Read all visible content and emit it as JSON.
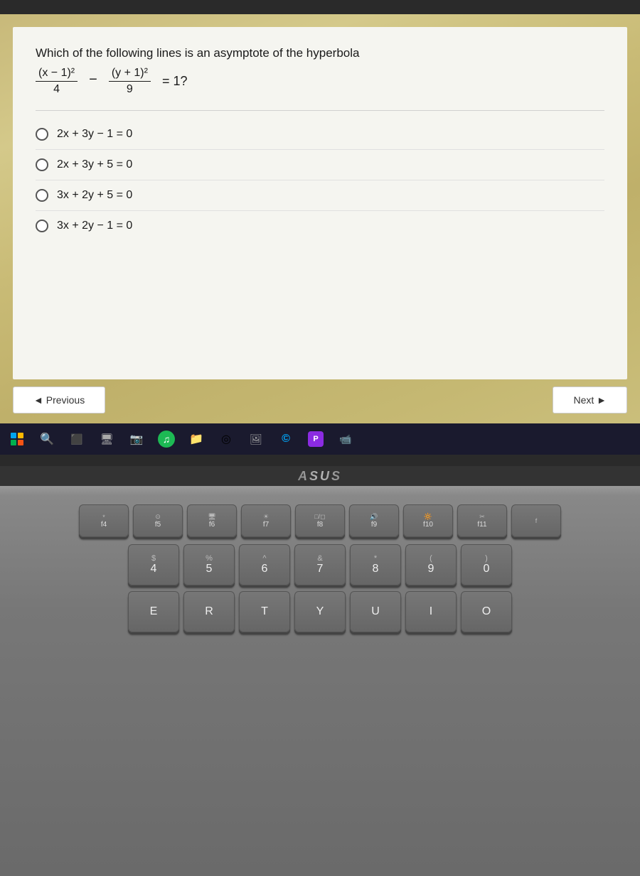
{
  "screen": {
    "question": {
      "main_text": "Which of the following lines is an asymptote of the hyperbola",
      "formula": {
        "numerator1": "(x − 1)²",
        "denominator1": "4",
        "numerator2": "(y + 1)²",
        "denominator2": "9",
        "equals": "= 1?"
      }
    },
    "options": [
      {
        "id": "opt1",
        "text": "2x + 3y − 1 = 0"
      },
      {
        "id": "opt2",
        "text": "2x + 3y + 5 = 0"
      },
      {
        "id": "opt3",
        "text": "3x + 2y + 5 = 0"
      },
      {
        "id": "opt4",
        "text": "3x + 2y − 1 = 0"
      }
    ],
    "nav": {
      "previous_label": "◄ Previous",
      "next_label": "Next ►"
    }
  },
  "taskbar": {
    "apps": [
      "⊞",
      "🔍",
      "□",
      "▪",
      "📷",
      "♫",
      "📁",
      "◎",
      "📷",
      "©",
      "P",
      "📹"
    ],
    "brand": "ASUS"
  },
  "keyboard": {
    "fn_row": [
      "f4",
      "f5",
      "f6",
      "f7",
      "f8",
      "f9",
      "f10",
      "f11",
      "f"
    ],
    "number_row": [
      {
        "top": "$",
        "bottom": "4"
      },
      {
        "top": "%",
        "bottom": "5"
      },
      {
        "top": "^",
        "bottom": "6"
      },
      {
        "top": "&",
        "bottom": "7"
      },
      {
        "top": "*",
        "bottom": "8"
      },
      {
        "top": "(",
        "bottom": "9"
      },
      {
        "top": ")",
        "bottom": "0"
      }
    ],
    "letter_row": [
      "E",
      "R",
      "T",
      "Y",
      "U",
      "I",
      "O"
    ]
  }
}
